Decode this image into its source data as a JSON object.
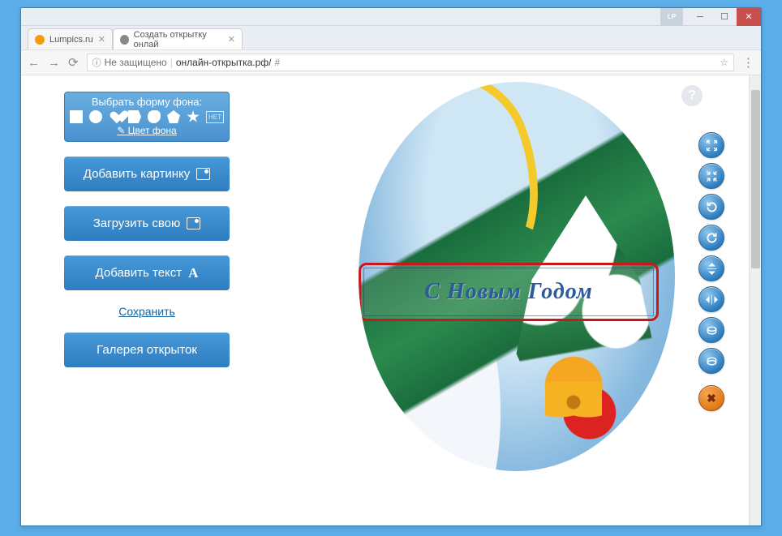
{
  "window": {
    "lp_badge": "LP"
  },
  "tabs": [
    {
      "label": "Lumpics.ru",
      "icon_color": "#f39c12"
    },
    {
      "label": "Создать открытку онлай",
      "icon_color": "#777"
    }
  ],
  "address": {
    "security_label": "Не защищено",
    "url_domain": "онлайн-открытка.рф/",
    "url_hash": "#"
  },
  "shape_panel": {
    "title": "Выбрать форму фона:",
    "none_label": "НЕТ",
    "bg_color_label": " Цвет фона"
  },
  "buttons": {
    "add_picture": "Добавить картинку",
    "upload_own": "Загрузить свою",
    "add_text": "Добавить текст",
    "gallery": "Галерея открыток"
  },
  "save_label": "Сохранить",
  "canvas_text": "С Новым Годом",
  "help": "?",
  "colors": {
    "accent": "#2e7dc0",
    "highlight": "#c8181b"
  }
}
